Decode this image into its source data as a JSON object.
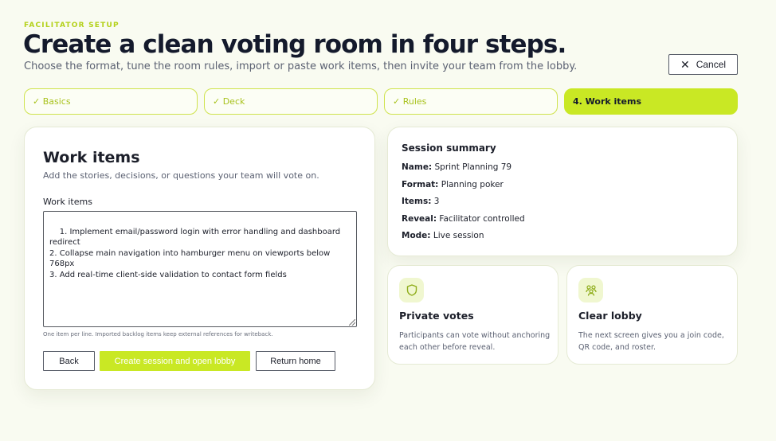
{
  "header": {
    "eyebrow": "FACILITATOR SETUP",
    "title": "Create a clean voting room in four steps.",
    "subtitle": "Choose the format, tune the room rules, import or paste work items, then invite your team from the lobby.",
    "cancel_label": "Cancel"
  },
  "steps": [
    {
      "label": "✓ Basics",
      "state": "complete"
    },
    {
      "label": "✓ Deck",
      "state": "complete"
    },
    {
      "label": "✓ Rules",
      "state": "complete"
    },
    {
      "label": "4. Work items",
      "state": "active"
    }
  ],
  "form": {
    "title": "Work items",
    "description": "Add the stories, decisions, or questions your team will vote on.",
    "field_label": "Work items",
    "field_value": "1. Implement email/password login with error handling and dashboard redirect\n2. Collapse main navigation into hamburger menu on viewports below 768px\n3. Add real-time client-side validation to contact form fields",
    "hint": "One item per line. Imported backlog items keep external references for writeback.",
    "back_label": "Back",
    "create_label": "Create session and open lobby",
    "home_label": "Return home"
  },
  "summary": {
    "title": "Session summary",
    "rows": [
      {
        "key": "Name:",
        "value": "Sprint Planning 79"
      },
      {
        "key": "Format:",
        "value": "Planning poker"
      },
      {
        "key": "Items:",
        "value": "3"
      },
      {
        "key": "Reveal:",
        "value": "Facilitator controlled"
      },
      {
        "key": "Mode:",
        "value": "Live session"
      }
    ]
  },
  "features": [
    {
      "icon": "shield-icon",
      "title": "Private votes",
      "text": "Participants can vote without anchoring each other before reveal."
    },
    {
      "icon": "people-icon",
      "title": "Clear lobby",
      "text": "The next screen gives you a join code, QR code, and roster."
    }
  ],
  "colors": {
    "accent": "#c9e824",
    "background": "#f9fbf1",
    "text": "#141a2c"
  }
}
